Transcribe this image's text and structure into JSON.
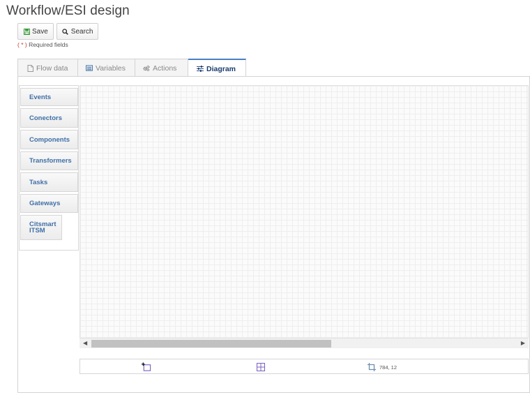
{
  "page": {
    "title": "Workflow/ESI design"
  },
  "toolbar": {
    "save_label": "Save",
    "search_label": "Search"
  },
  "required_note": {
    "star": "( * )",
    "text": " Required fields"
  },
  "tabs": [
    {
      "label": "Flow data",
      "icon": "document-icon",
      "active": false
    },
    {
      "label": "Variables",
      "icon": "list-icon",
      "active": false
    },
    {
      "label": "Actions",
      "icon": "gears-icon",
      "active": false
    },
    {
      "label": "Diagram",
      "icon": "sliders-icon",
      "active": true
    }
  ],
  "palette": {
    "items": [
      {
        "label": "Events"
      },
      {
        "label": "Conectors"
      },
      {
        "label": "Components"
      },
      {
        "label": "Transformers"
      },
      {
        "label": "Tasks"
      },
      {
        "label": "Gateways"
      },
      {
        "label": "Citsmart ITSM"
      }
    ]
  },
  "statusbar": {
    "coordinates": "784, 12"
  },
  "colors": {
    "accent": "#4a7fc1",
    "palette_text": "#3f6fa6",
    "tool_icon": "#7b5fc4"
  }
}
